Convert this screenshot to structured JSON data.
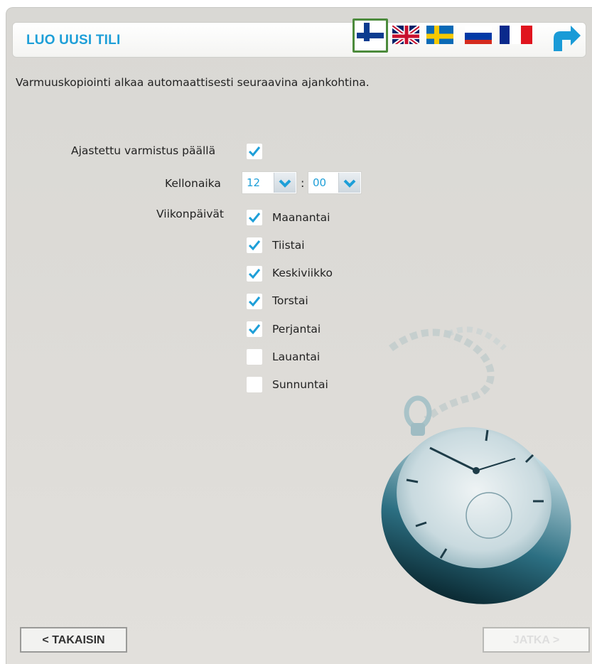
{
  "header": {
    "title": "LUO UUSI TILI",
    "languages": [
      {
        "code": "fi",
        "icon": "finland-flag-icon",
        "selected": true
      },
      {
        "code": "en",
        "icon": "uk-flag-icon",
        "selected": false
      },
      {
        "code": "sv",
        "icon": "sweden-flag-icon",
        "selected": false
      },
      {
        "code": "ru",
        "icon": "russia-flag-icon",
        "selected": false
      },
      {
        "code": "fr",
        "icon": "france-flag-icon",
        "selected": false
      }
    ],
    "back_icon": "return-arrow-icon"
  },
  "intro_text": "Varmuuskopiointi alkaa automaattisesti seuraavina ajankohtina.",
  "schedule": {
    "enabled_label": "Ajastettu varmistus päällä",
    "enabled": true,
    "time_label": "Kellonaika",
    "hour": "12",
    "separator": ":",
    "minute": "00",
    "weekdays_label": "Viikonpäivät",
    "days": [
      {
        "label": "Maanantai",
        "checked": true
      },
      {
        "label": "Tiistai",
        "checked": true
      },
      {
        "label": "Keskiviikko",
        "checked": true
      },
      {
        "label": "Torstai",
        "checked": true
      },
      {
        "label": "Perjantai",
        "checked": true
      },
      {
        "label": "Lauantai",
        "checked": false
      },
      {
        "label": "Sunnuntai",
        "checked": false
      }
    ]
  },
  "footer": {
    "back_label": "< TAKAISIN",
    "next_label": "JATKA >"
  },
  "colors": {
    "accent": "#1e9fd8",
    "background": "#dcdbd7",
    "selected_flag_border": "#4c8b3c"
  }
}
